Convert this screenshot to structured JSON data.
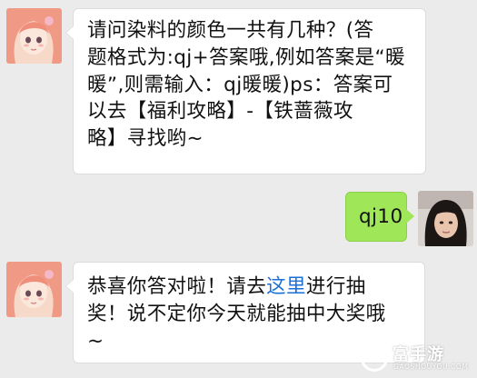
{
  "messages": [
    {
      "sender": "left",
      "avatar_icon": "anime-girl-avatar",
      "lines": [
        "请问染料的颜色一共有几种？(答",
        "题格式为:qj+答案哦,例如答案是“暖",
        "暖”,则需输入：qj暖暖)ps：答案可",
        "以去【福利攻略】-【铁蔷薇攻",
        "略】寻找哟~"
      ]
    },
    {
      "sender": "right",
      "avatar_icon": "user-photo-avatar",
      "text": "qj10"
    },
    {
      "sender": "left",
      "avatar_icon": "anime-girl-avatar",
      "line1_before": "恭喜你答对啦！请去",
      "line1_link": "这里",
      "line1_after": "进行抽",
      "line2": "奖！说不定你今天就能抽中大奖哦",
      "line3": "~"
    }
  ],
  "watermark": {
    "logo_letter": "G",
    "name": "富手游",
    "url": "GAOSHOUYOU.COM"
  },
  "colors": {
    "background": "#ebebeb",
    "bubble_in": "#ffffff",
    "bubble_out": "#9fe658",
    "link": "#1b6fd6"
  }
}
